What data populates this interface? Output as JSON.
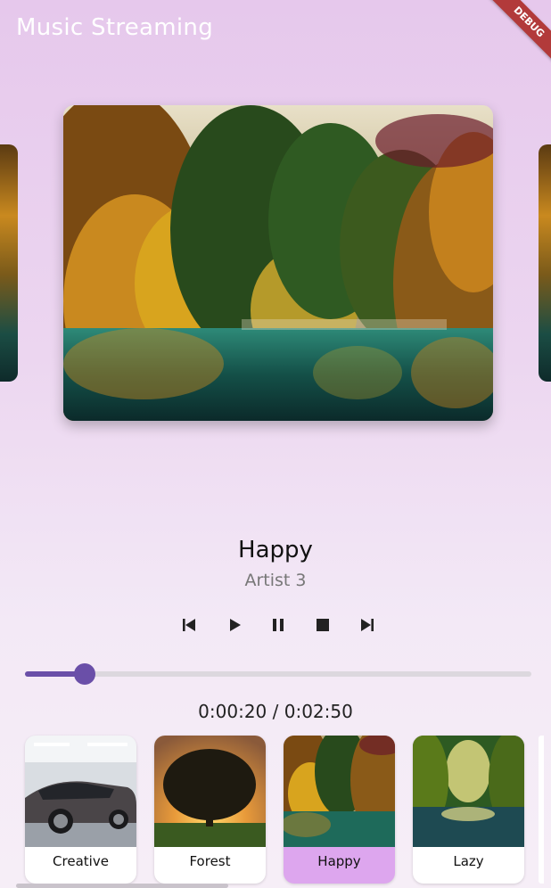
{
  "app": {
    "title": "Music Streaming",
    "debug_label": "DEBUG"
  },
  "now_playing": {
    "title": "Happy",
    "artist": "Artist 3"
  },
  "controls": {
    "previous": "skip-previous-icon",
    "play": "play-icon",
    "pause": "pause-icon",
    "stop": "stop-icon",
    "next": "skip-next-icon"
  },
  "progress": {
    "position": "0:00:20",
    "duration": "0:02:50",
    "fraction": 0.118
  },
  "time_display": "0:00:20 / 0:02:50",
  "playlist": [
    {
      "label": "Creative",
      "active": false
    },
    {
      "label": "Forest",
      "active": false
    },
    {
      "label": "Happy",
      "active": true
    },
    {
      "label": "Lazy",
      "active": false
    }
  ],
  "colors": {
    "accent": "#6a4fa8",
    "active_card": "#dda6ee",
    "debug": "#b23a3a"
  }
}
